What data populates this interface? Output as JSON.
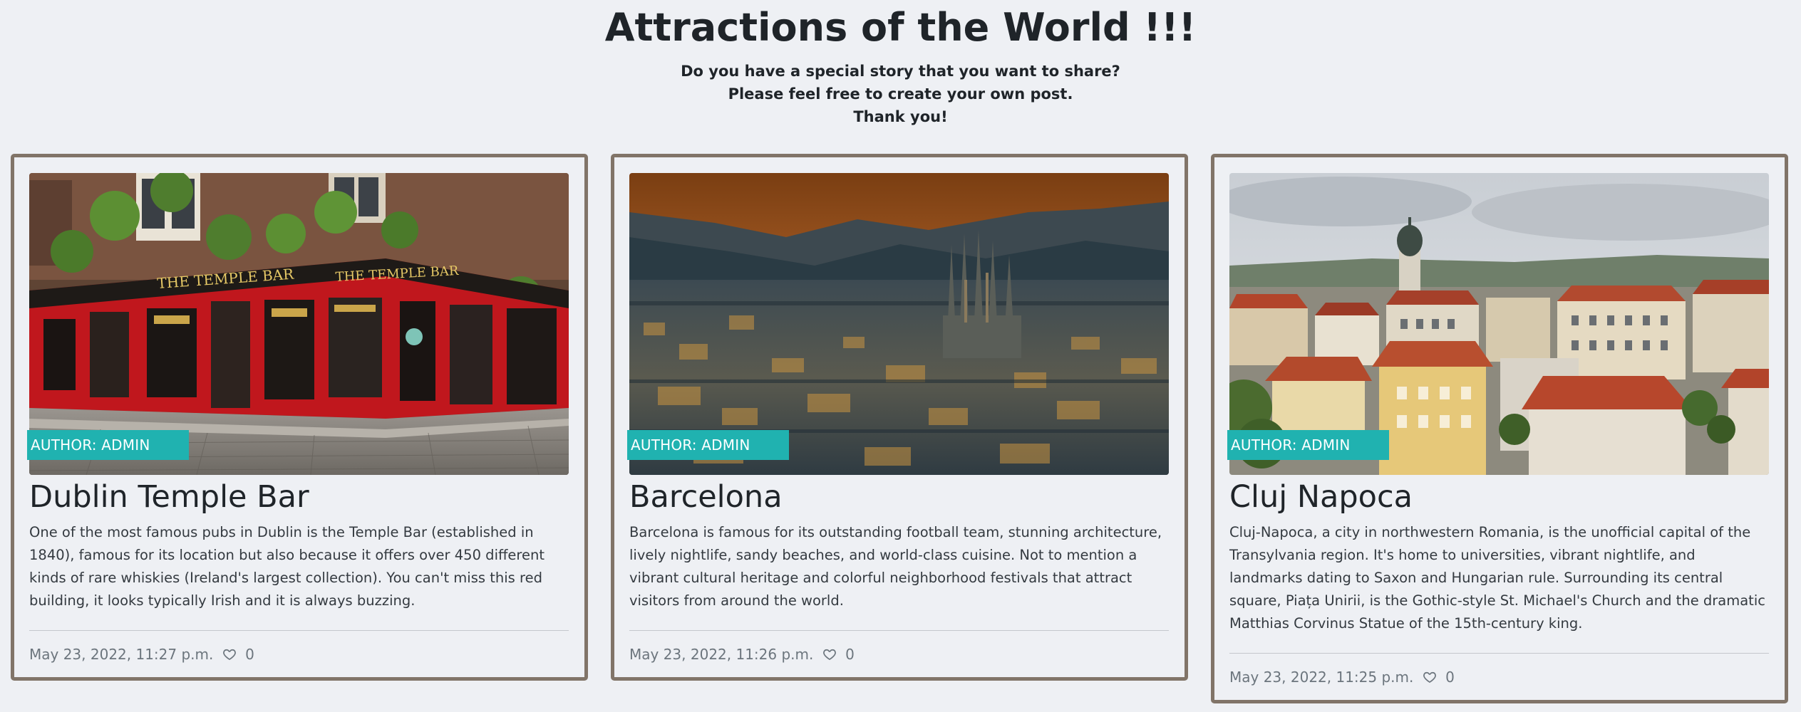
{
  "page": {
    "title": "Attractions of the World !!!",
    "intro_line1": "Do you have a special story that you want to share?",
    "intro_line2": "Please feel free to create your own post.",
    "intro_line3": "Thank you!"
  },
  "posts": [
    {
      "author": "AUTHOR: ADMIN",
      "title": "Dublin Temple Bar",
      "text": "One of the most famous pubs in Dublin is the Temple Bar (established in 1840), famous for its location but also because it offers over 450 different kinds of rare whiskies (Ireland's largest collection). You can't miss this red building, it looks typically Irish and it is always buzzing.",
      "date": "May 23, 2022, 11:27 p.m.",
      "likes": "0",
      "image_sign": "THE TEMPLE BAR"
    },
    {
      "author": "AUTHOR: ADMIN",
      "title": "Barcelona",
      "text": "Barcelona is famous for its outstanding football team, stunning architecture, lively nightlife, sandy beaches, and world-class cuisine. Not to mention a vibrant cultural heritage and colorful neighborhood festivals that attract visitors from around the world.",
      "date": "May 23, 2022, 11:26 p.m.",
      "likes": "0"
    },
    {
      "author": "AUTHOR: ADMIN",
      "title": "Cluj Napoca",
      "text": "Cluj-Napoca, a city in northwestern Romania, is the unofficial capital of the Transylvania region. It's home to universities, vibrant nightlife, and landmarks dating to Saxon and Hungarian rule. Surrounding its central square, Piața Unirii, is the Gothic-style St. Michael's Church and the dramatic Matthias Corvinus Statue of the 15th-century king.",
      "date": "May 23, 2022, 11:25 p.m.",
      "likes": "0"
    }
  ],
  "colors": {
    "background": "#eef0f4",
    "card_border": "#817468",
    "author_badge": "#20b2b0",
    "footer_text": "#6c757d"
  },
  "icons": {
    "like": "heart-icon"
  }
}
